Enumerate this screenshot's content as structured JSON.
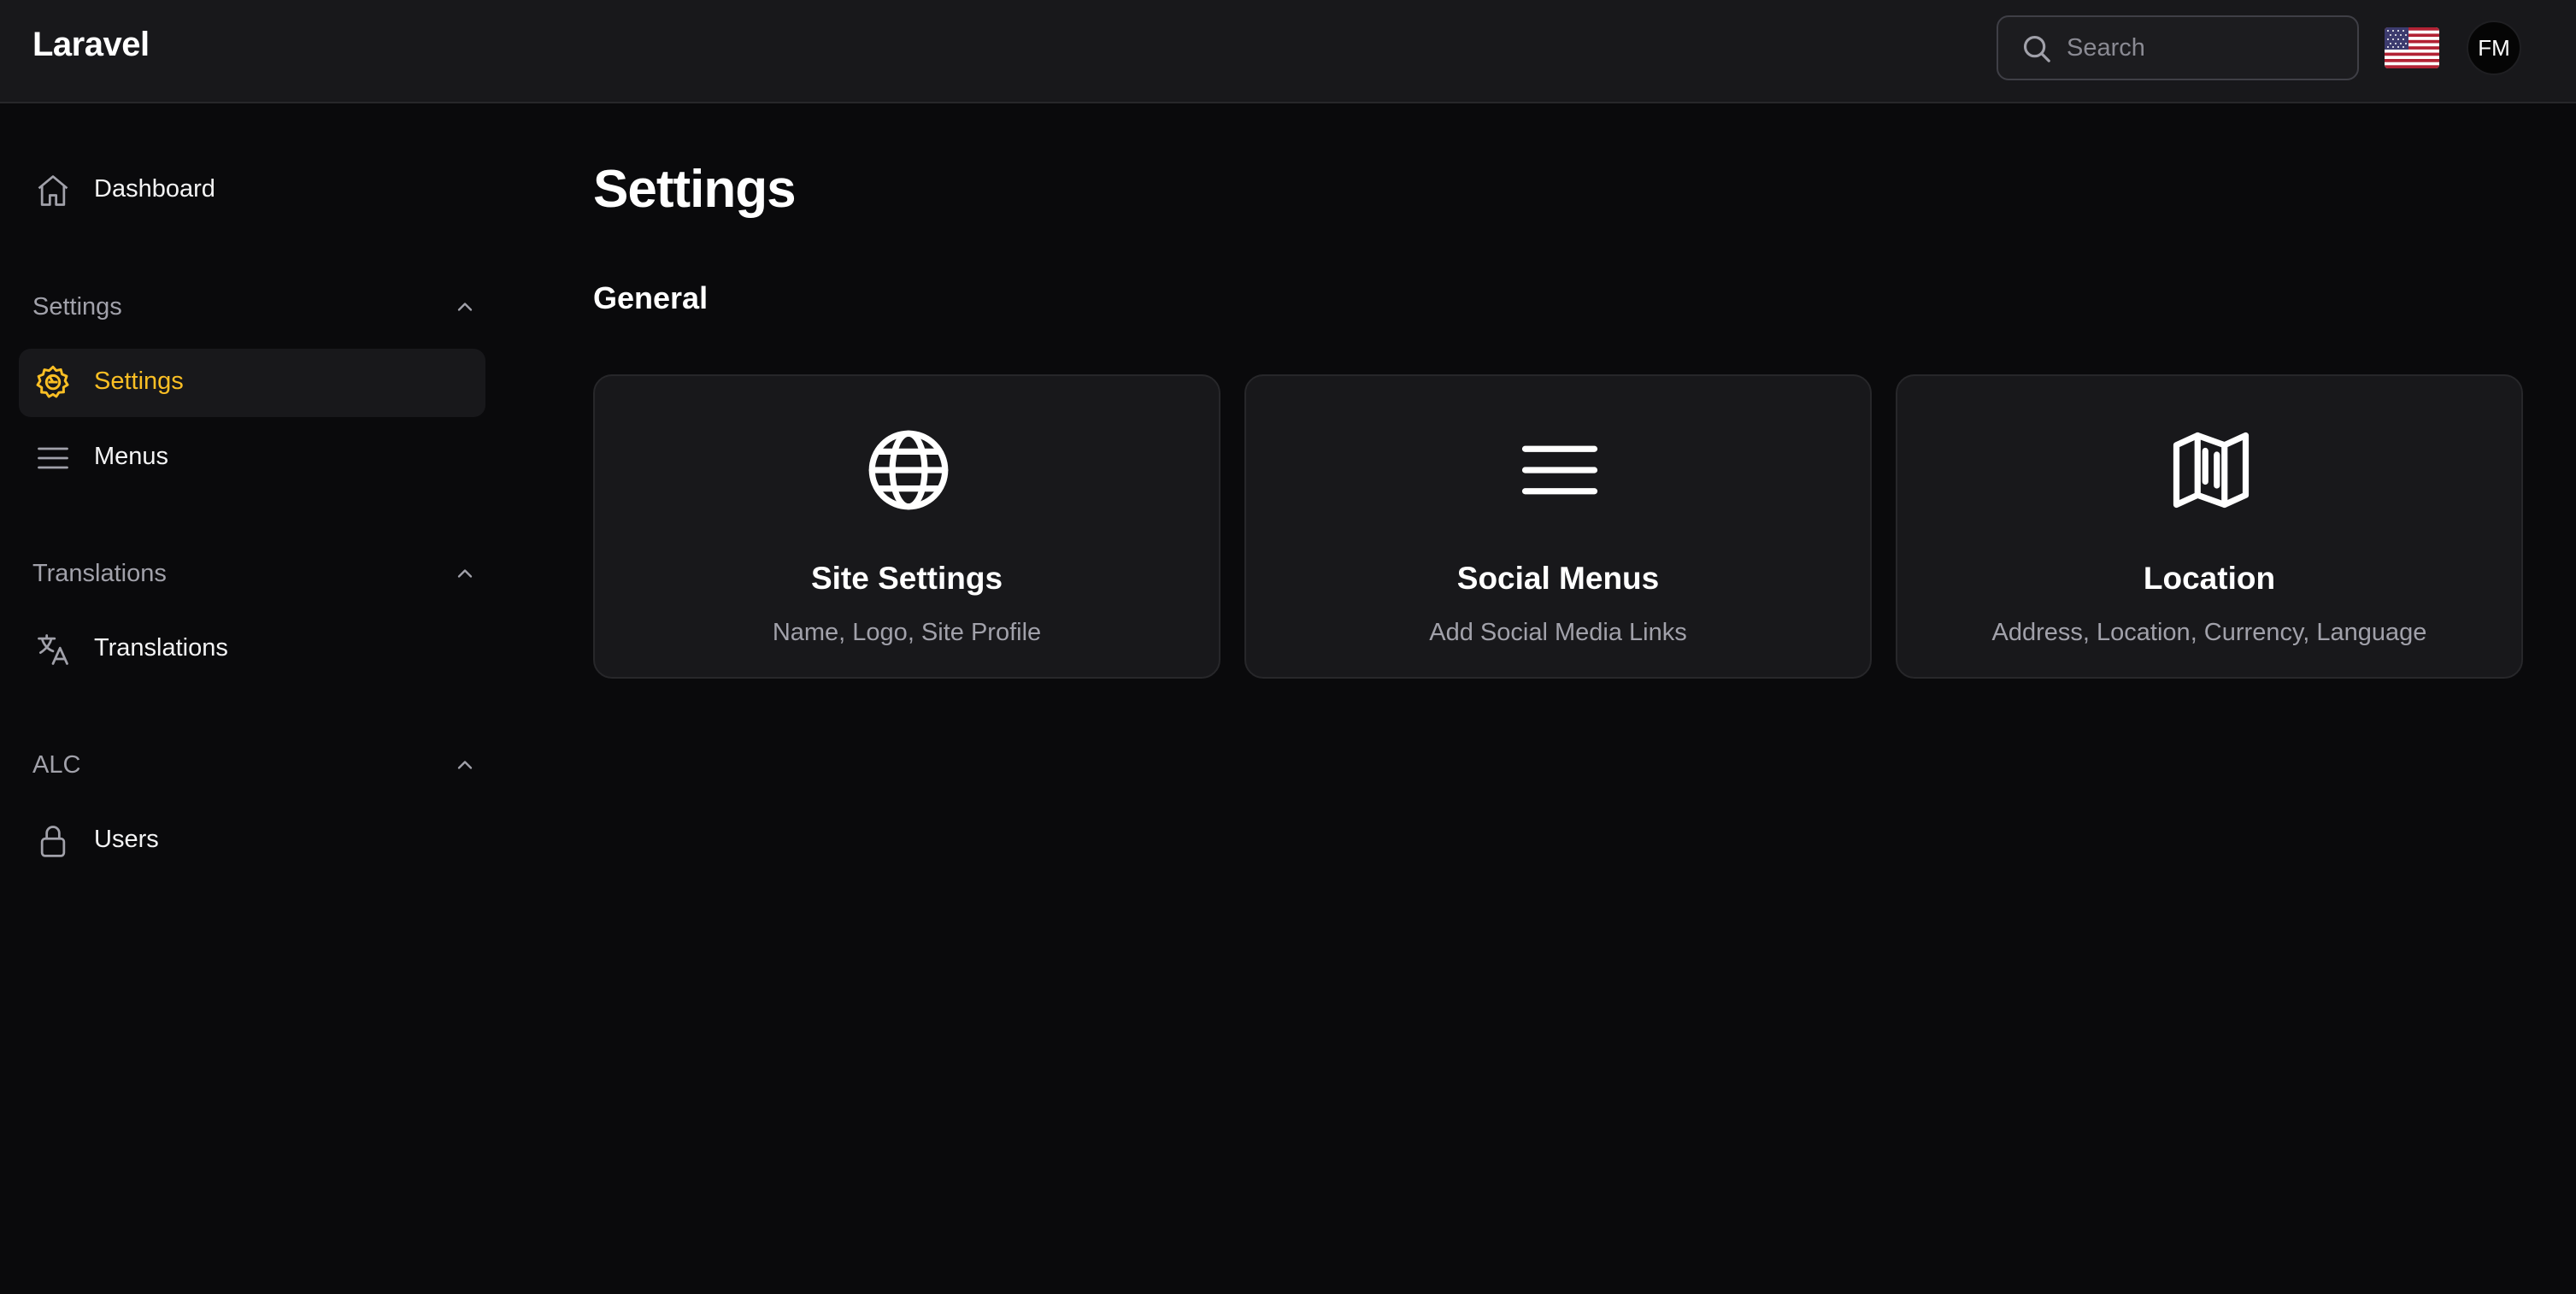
{
  "app": {
    "brand": "Laravel"
  },
  "header": {
    "search_placeholder": "Search",
    "avatar_initials": "FM",
    "language_flag": "us-flag-icon"
  },
  "sidebar": {
    "dashboard": {
      "label": "Dashboard",
      "icon": "home-icon"
    },
    "groups": [
      {
        "label": "Settings",
        "items": [
          {
            "label": "Settings",
            "icon": "gear-icon",
            "active": true
          },
          {
            "label": "Menus",
            "icon": "menu-icon"
          }
        ]
      },
      {
        "label": "Translations",
        "items": [
          {
            "label": "Translations",
            "icon": "translate-icon"
          }
        ]
      },
      {
        "label": "ALC",
        "items": [
          {
            "label": "Users",
            "icon": "lock-icon"
          }
        ]
      }
    ]
  },
  "main": {
    "title": "Settings",
    "section": "General",
    "cards": [
      {
        "title": "Site Settings",
        "description": "Name, Logo, Site Profile",
        "icon": "globe-icon"
      },
      {
        "title": "Social Menus",
        "description": "Add Social Media Links",
        "icon": "menu-icon"
      },
      {
        "title": "Location",
        "description": "Address, Location, Currency, Language",
        "icon": "map-icon"
      }
    ]
  },
  "colors": {
    "accent": "#fbbf24",
    "background": "#0a0a0c",
    "surface": "#18181b",
    "border": "#27272a"
  }
}
